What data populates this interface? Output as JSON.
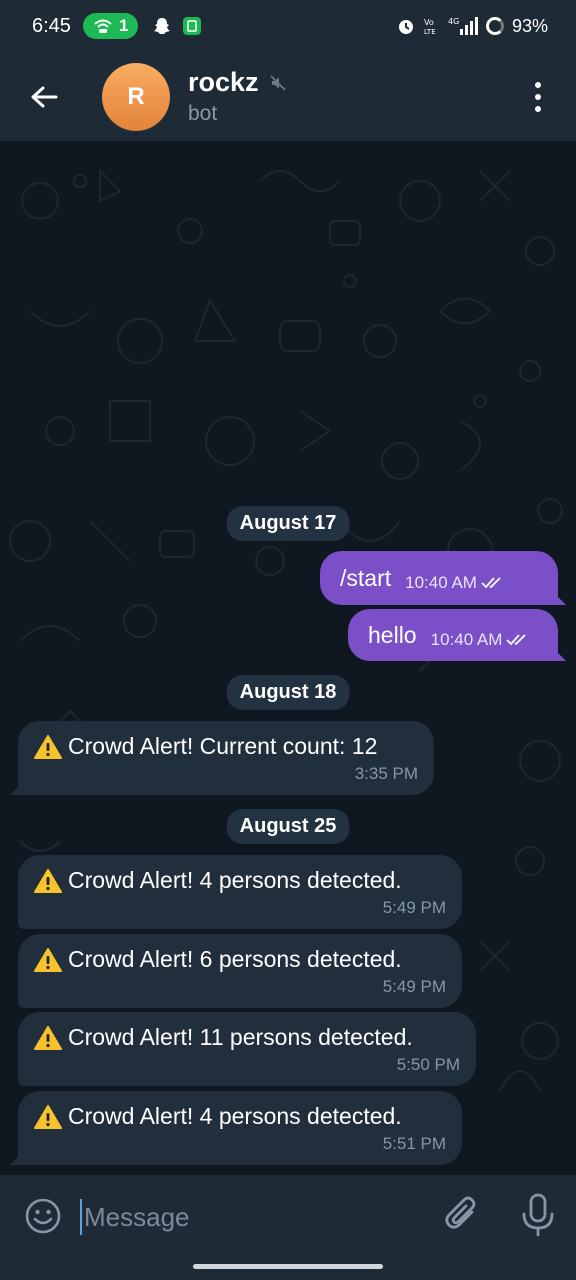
{
  "status_bar": {
    "time": "6:45",
    "hotspot_count": "1",
    "battery": "93%",
    "network": "4G"
  },
  "header": {
    "avatar_letter": "R",
    "name": "rockz",
    "subtitle": "bot"
  },
  "colors": {
    "header_bg": "#1e2a36",
    "outgoing_bubble": "#7a4fc8",
    "incoming_bubble": "#212f3d",
    "avatar": "#f0993f"
  },
  "messages": {
    "date_aug17": "August 17",
    "out1_text": "/start",
    "out1_time": "10:40 AM",
    "out2_text": "hello",
    "out2_time": "10:40 AM",
    "date_aug18": "August 18",
    "in1_text": "Crowd Alert! Current count: 12",
    "in1_time": "3:35 PM",
    "date_aug25": "August 25",
    "in2_text": "Crowd Alert! 4 persons detected.",
    "in2_time": "5:49 PM",
    "in3_text": "Crowd Alert! 6 persons detected.",
    "in3_time": "5:49 PM",
    "in4_text": "Crowd Alert! 11 persons detected.",
    "in4_time": "5:50 PM",
    "in5_text": "Crowd Alert! 4 persons detected.",
    "in5_time": "5:51 PM",
    "alert_icon": "warning-icon"
  },
  "input": {
    "placeholder": "Message"
  }
}
